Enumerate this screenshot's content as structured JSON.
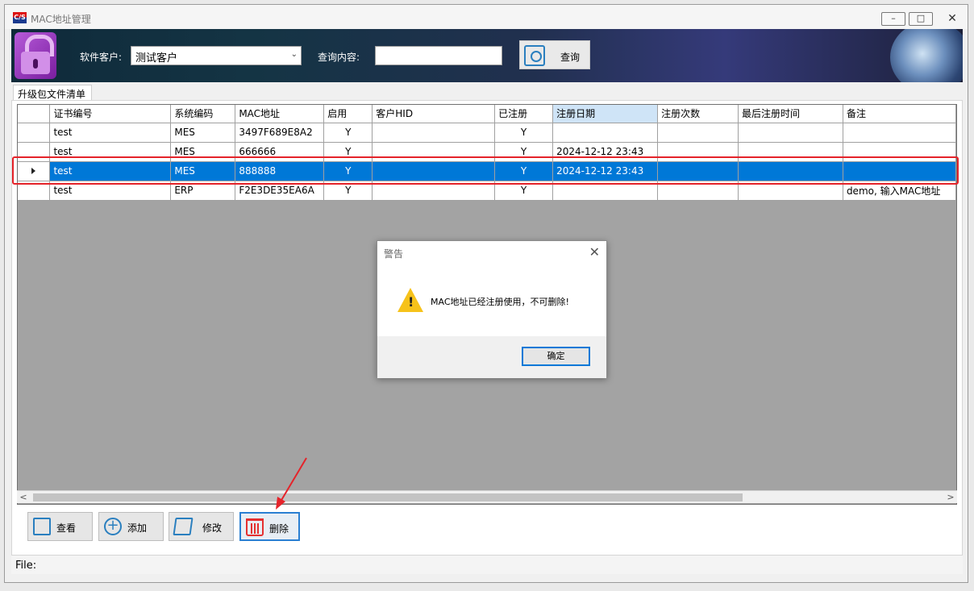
{
  "window": {
    "title": "MAC地址管理",
    "app_icon_text": "C/S"
  },
  "header": {
    "customer_label": "软件客户:",
    "customer_value": "测试客户",
    "query_label": "查询内容:",
    "query_value": "",
    "search_button": "查询"
  },
  "tab": {
    "label": "升级包文件清单"
  },
  "table": {
    "columns": [
      "证书编号",
      "系统编码",
      "MAC地址",
      "启用",
      "客户HID",
      "已注册",
      "注册日期",
      "注册次数",
      "最后注册时间",
      "备注"
    ],
    "rows": [
      [
        "test",
        "MES",
        "3497F689E8A2",
        "Y",
        "",
        "Y",
        "",
        "",
        "",
        ""
      ],
      [
        "test",
        "MES",
        "666666",
        "Y",
        "",
        "Y",
        "2024-12-12 23:43",
        "",
        "",
        ""
      ],
      [
        "test",
        "MES",
        "888888",
        "Y",
        "",
        "Y",
        "2024-12-12 23:43",
        "",
        "",
        ""
      ],
      [
        "test",
        "ERP",
        "F2E3DE35EA6A",
        "Y",
        "",
        "Y",
        "",
        "",
        "",
        "demo, 输入MAC地址"
      ]
    ]
  },
  "buttons": {
    "view": "查看",
    "add": "添加",
    "edit": "修改",
    "delete": "删除"
  },
  "status": {
    "text": "File:"
  },
  "dialog": {
    "title": "警告",
    "message": "MAC地址已经注册使用，不可删除!",
    "ok": "确定"
  }
}
